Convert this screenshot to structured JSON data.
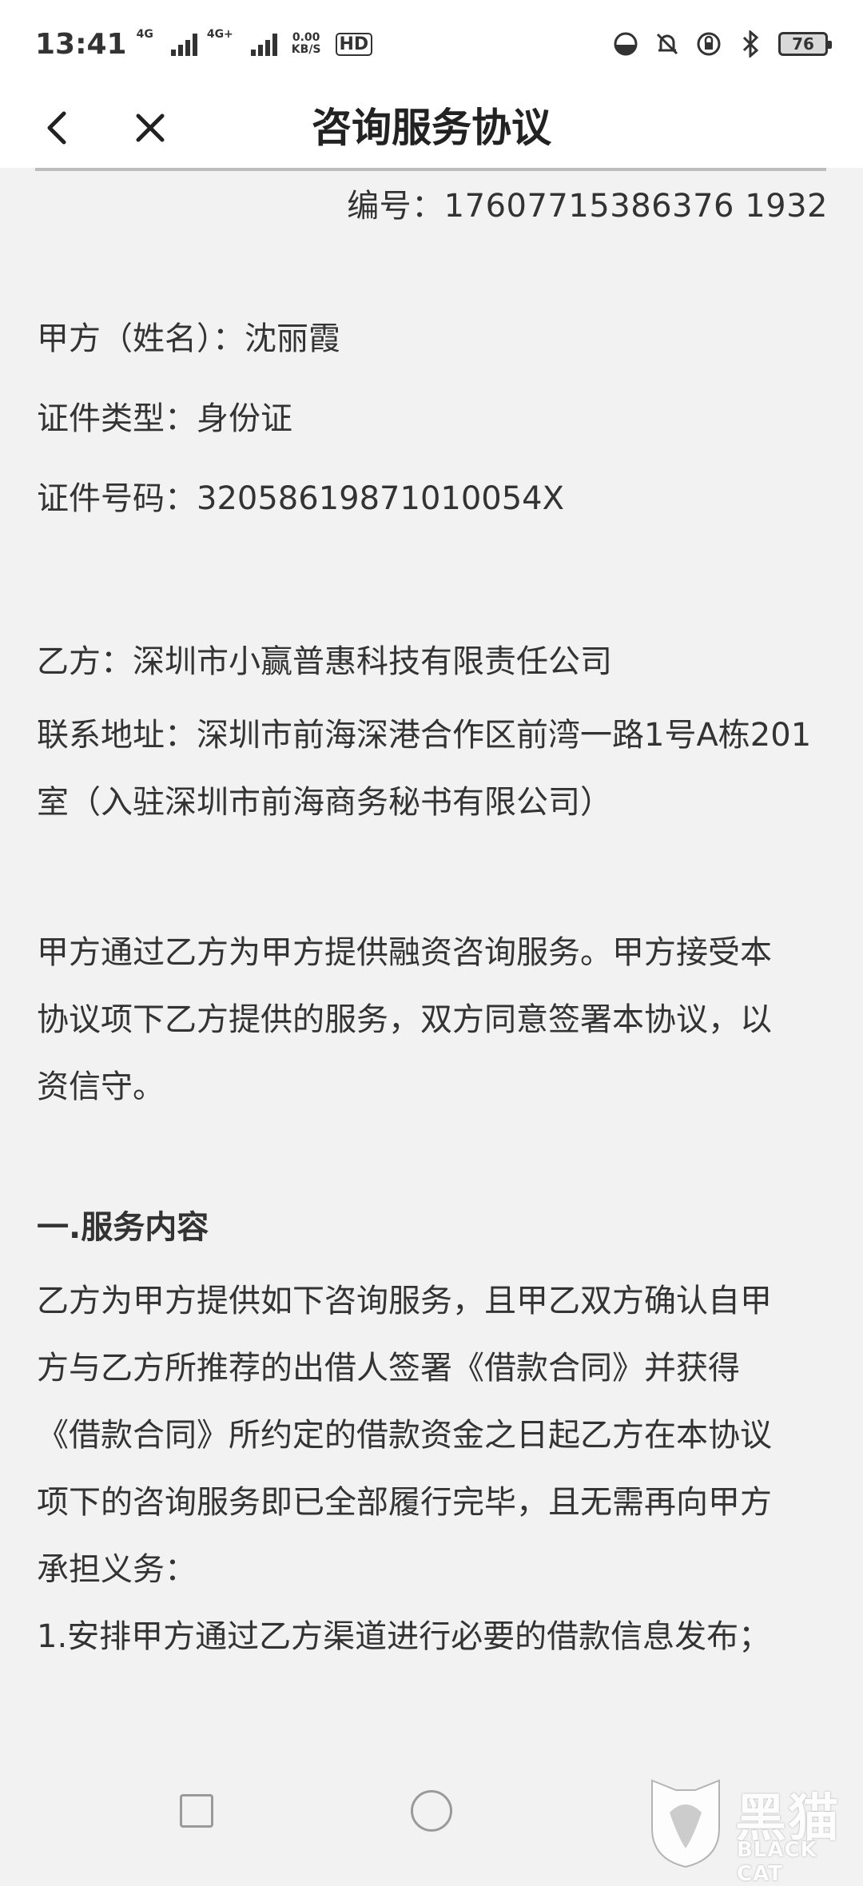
{
  "status_bar": {
    "time": "13:41",
    "signal1_label": "4G",
    "signal2_label": "4G+",
    "net_speed_value": "0.00",
    "net_speed_unit": "KB/S",
    "hd_badge": "HD",
    "battery_level": "76"
  },
  "header": {
    "title": "咨询服务协议",
    "back_icon": "chevron-left-icon",
    "close_icon": "close-icon"
  },
  "document": {
    "number": "编号：17607715386376 1932",
    "party_a_name": "甲方（姓名）：沈丽霞",
    "id_type": "证件类型：身份证",
    "id_number": "证件号码：32058619871010054X",
    "party_b": "乙方：深圳市小赢普惠科技有限责任公司",
    "address_line1": "联系地址：深圳市前海深港合作区前湾一路1号A栋201",
    "address_line2": "室（入驻深圳市前海商务秘书有限公司）",
    "intro_line1": "甲方通过乙方为甲方提供融资咨询服务。甲方接受本",
    "intro_line2": "协议项下乙方提供的服务，双方同意签署本协议，以",
    "intro_line3": "资信守。",
    "section1_heading": "一.服务内容",
    "s1_line1": "乙方为甲方提供如下咨询服务，且甲乙双方确认自甲",
    "s1_line2": "方与乙方所推荐的出借人签署《借款合同》并获得",
    "s1_line3": "《借款合同》所约定的借款资金之日起乙方在本协议",
    "s1_line4": "项下的咨询服务即已全部履行完毕，且无需再向甲方",
    "s1_line5": "承担义务：",
    "item1": "1.安排甲方通过乙方渠道进行必要的借款信息发布；"
  },
  "watermark": {
    "cn": "黑猫",
    "en": "BLACK CAT"
  },
  "colors": {
    "background": "#f2f2f2",
    "bar": "#ffffff",
    "text": "#333333",
    "rule": "#bdbdbd"
  }
}
